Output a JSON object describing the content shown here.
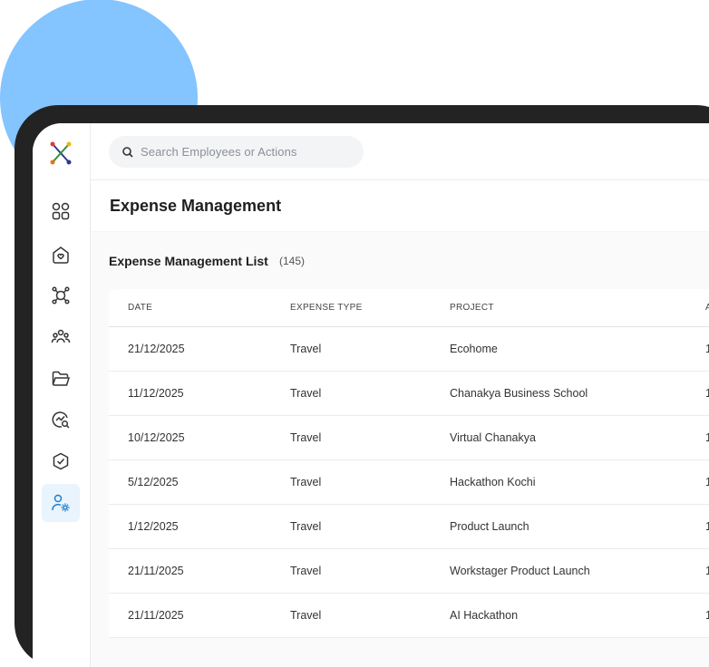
{
  "search": {
    "placeholder": "Search Employees or Actions"
  },
  "page": {
    "title": "Expense Management"
  },
  "list": {
    "title": "Expense Management List",
    "count": "(145)"
  },
  "table": {
    "columns": [
      "DATE",
      "EXPENSE TYPE",
      "PROJECT",
      "A"
    ],
    "rows": [
      {
        "date": "21/12/2025",
        "type": "Travel",
        "project": "Ecohome",
        "amount": "1"
      },
      {
        "date": "11/12/2025",
        "type": "Travel",
        "project": "Chanakya Business School",
        "amount": "1"
      },
      {
        "date": "10/12/2025",
        "type": "Travel",
        "project": "Virtual Chanakya",
        "amount": "1"
      },
      {
        "date": "5/12/2025",
        "type": "Travel",
        "project": "Hackathon Kochi",
        "amount": "1"
      },
      {
        "date": "1/12/2025",
        "type": "Travel",
        "project": "Product Launch",
        "amount": "1"
      },
      {
        "date": "21/11/2025",
        "type": "Travel",
        "project": "Workstager Product Launch",
        "amount": "1"
      },
      {
        "date": "21/11/2025",
        "type": "Travel",
        "project": "AI Hackathon",
        "amount": "1"
      }
    ]
  },
  "sidebar": {
    "items": [
      {
        "icon": "grid-icon",
        "active": false
      },
      {
        "icon": "home-heart-icon",
        "active": false
      },
      {
        "icon": "network-icon",
        "active": false
      },
      {
        "icon": "team-icon",
        "active": false
      },
      {
        "icon": "folder-icon",
        "active": false
      },
      {
        "icon": "analytics-icon",
        "active": false
      },
      {
        "icon": "check-badge-icon",
        "active": false
      },
      {
        "icon": "user-settings-icon",
        "active": true
      }
    ]
  },
  "colors": {
    "accent": "#1d7fd0",
    "blob": "#84c4ff",
    "frame": "#232323"
  }
}
